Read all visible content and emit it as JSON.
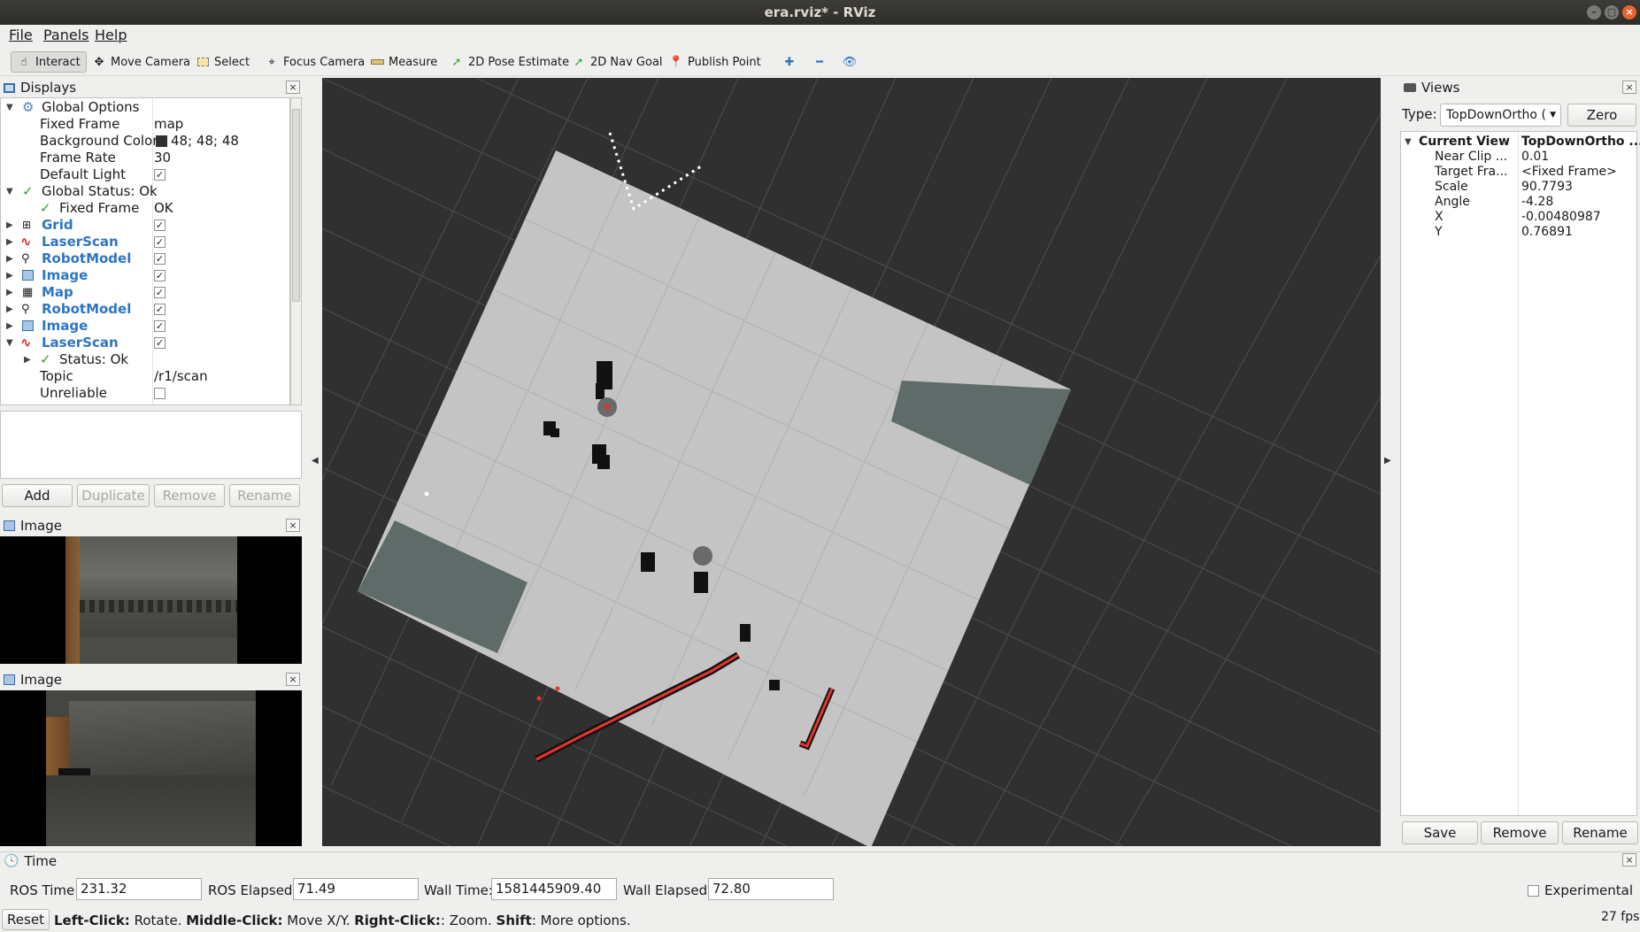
{
  "window": {
    "title": "era.rviz* - RViz"
  },
  "menu": {
    "file": "File",
    "panels": "Panels",
    "help": "Help"
  },
  "toolbar": {
    "interact": "Interact",
    "move_camera": "Move Camera",
    "select": "Select",
    "focus_camera": "Focus Camera",
    "measure": "Measure",
    "pose_estimate": "2D Pose Estimate",
    "nav_goal": "2D Nav Goal",
    "publish_point": "Publish Point"
  },
  "displays": {
    "title": "Displays",
    "rows": [
      {
        "key": "Global Options",
        "value": ""
      },
      {
        "key": "Fixed Frame",
        "value": "map"
      },
      {
        "key": "Background Color",
        "value": "48; 48; 48"
      },
      {
        "key": "Frame Rate",
        "value": "30"
      },
      {
        "key": "Default Light",
        "value": "✓"
      },
      {
        "key": "Global Status: Ok",
        "value": ""
      },
      {
        "key": "Fixed Frame",
        "value": "OK"
      },
      {
        "key": "Grid",
        "value": "✓"
      },
      {
        "key": "LaserScan",
        "value": "✓"
      },
      {
        "key": "RobotModel",
        "value": "✓"
      },
      {
        "key": "Image",
        "value": "✓"
      },
      {
        "key": "Map",
        "value": "✓"
      },
      {
        "key": "RobotModel",
        "value": "✓"
      },
      {
        "key": "Image",
        "value": "✓"
      },
      {
        "key": "LaserScan",
        "value": "✓"
      },
      {
        "key": "Status: Ok",
        "value": ""
      },
      {
        "key": "Topic",
        "value": "/r1/scan"
      },
      {
        "key": "Unreliable",
        "value": ""
      }
    ],
    "buttons": {
      "add": "Add",
      "duplicate": "Duplicate",
      "remove": "Remove",
      "rename": "Rename"
    }
  },
  "image_panel_1": {
    "title": "Image"
  },
  "image_panel_2": {
    "title": "Image"
  },
  "views": {
    "title": "Views",
    "type_label": "Type:",
    "type_value": "TopDownOrtho (",
    "zero": "Zero",
    "rows": [
      {
        "key": "Current View",
        "value": "TopDownOrtho ..."
      },
      {
        "key": "Near Clip ...",
        "value": "0.01"
      },
      {
        "key": "Target Fra...",
        "value": "<Fixed Frame>"
      },
      {
        "key": "Scale",
        "value": "90.7793"
      },
      {
        "key": "Angle",
        "value": "-4.28"
      },
      {
        "key": "X",
        "value": "-0.00480987"
      },
      {
        "key": "Y",
        "value": "0.76891"
      }
    ],
    "buttons": {
      "save": "Save",
      "remove": "Remove",
      "rename": "Rename"
    }
  },
  "time": {
    "title": "Time",
    "ros_time_label": "ROS Time:",
    "ros_time": "231.32",
    "ros_elapsed_label": "ROS Elapsed:",
    "ros_elapsed": "71.49",
    "wall_time_label": "Wall Time:",
    "wall_time": "1581445909.40",
    "wall_elapsed_label": "Wall Elapsed:",
    "wall_elapsed": "72.80",
    "experimental": "Experimental"
  },
  "status": {
    "reset": "Reset",
    "left_click": "Left-Click:",
    "left_text": " Rotate. ",
    "middle_click": "Middle-Click:",
    "middle_text": " Move X/Y. ",
    "right_click": "Right-Click:",
    "right_text": ": Zoom. ",
    "shift": "Shift",
    "shift_text": ": More options.",
    "fps": "27 fps"
  },
  "colors": {
    "background": "#303030",
    "map_free": "#c4c4c4",
    "laser": "#e8322b",
    "accent": "#2d74c3"
  }
}
